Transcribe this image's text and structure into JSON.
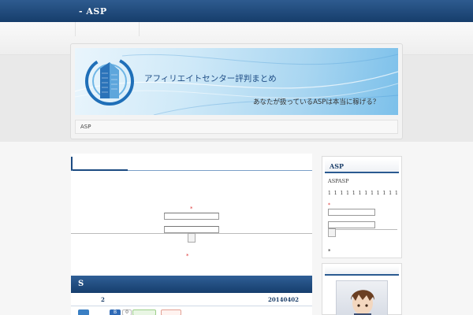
{
  "site": {
    "title": "- ASP"
  },
  "banner": {
    "title": "アフィリエイトセンター評判まとめ",
    "subtitle": "あなたが扱っているASPは本当に稼げる？"
  },
  "breadcrumb": "ASP",
  "main": {
    "required_mark": "*",
    "section_title": "S",
    "entry": {
      "number": "2",
      "date": "20140402"
    },
    "share": {
      "hatena_label": "B",
      "hatena_count": "0"
    }
  },
  "sidebar": {
    "widget_title": "ASP",
    "line1": "ASPASP",
    "line2": "1 1 1 1 1 1 1 1 1 1 1 1",
    "required_mark": "*",
    "footer_mark": "*"
  },
  "colors": {
    "topbar": "#1f4a7c",
    "accent_blue": "#1c4b82",
    "required_red": "#dd3333"
  }
}
